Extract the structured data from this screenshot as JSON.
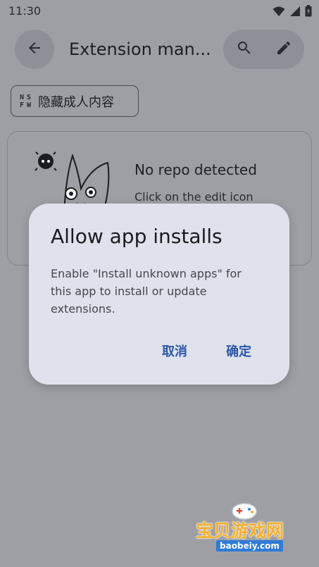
{
  "status_bar": {
    "time": "11:30"
  },
  "top_bar": {
    "title": "Extension man..."
  },
  "nsfw_chip": {
    "badge": [
      "N",
      "S",
      "F",
      "W"
    ],
    "label": "隐藏成人内容"
  },
  "empty_state": {
    "title": "No repo detected",
    "description": "Click on the edit icon"
  },
  "dialog": {
    "title": "Allow app installs",
    "body": "Enable \"Install unknown apps\" for this app to install or update extensions.",
    "cancel_label": "取消",
    "confirm_label": "确定"
  },
  "watermark": {
    "text": "宝贝游戏网",
    "url": "baobeiy.com"
  },
  "colors": {
    "scrim_background": "#9e9fa4",
    "dialog_surface": "#dfe2ec",
    "dialog_action": "#2c57a8"
  },
  "icons": [
    "wifi-icon",
    "signal-icon",
    "battery-icon",
    "back-arrow-icon",
    "search-icon",
    "edit-pencil-icon",
    "mascot-illustration"
  ]
}
